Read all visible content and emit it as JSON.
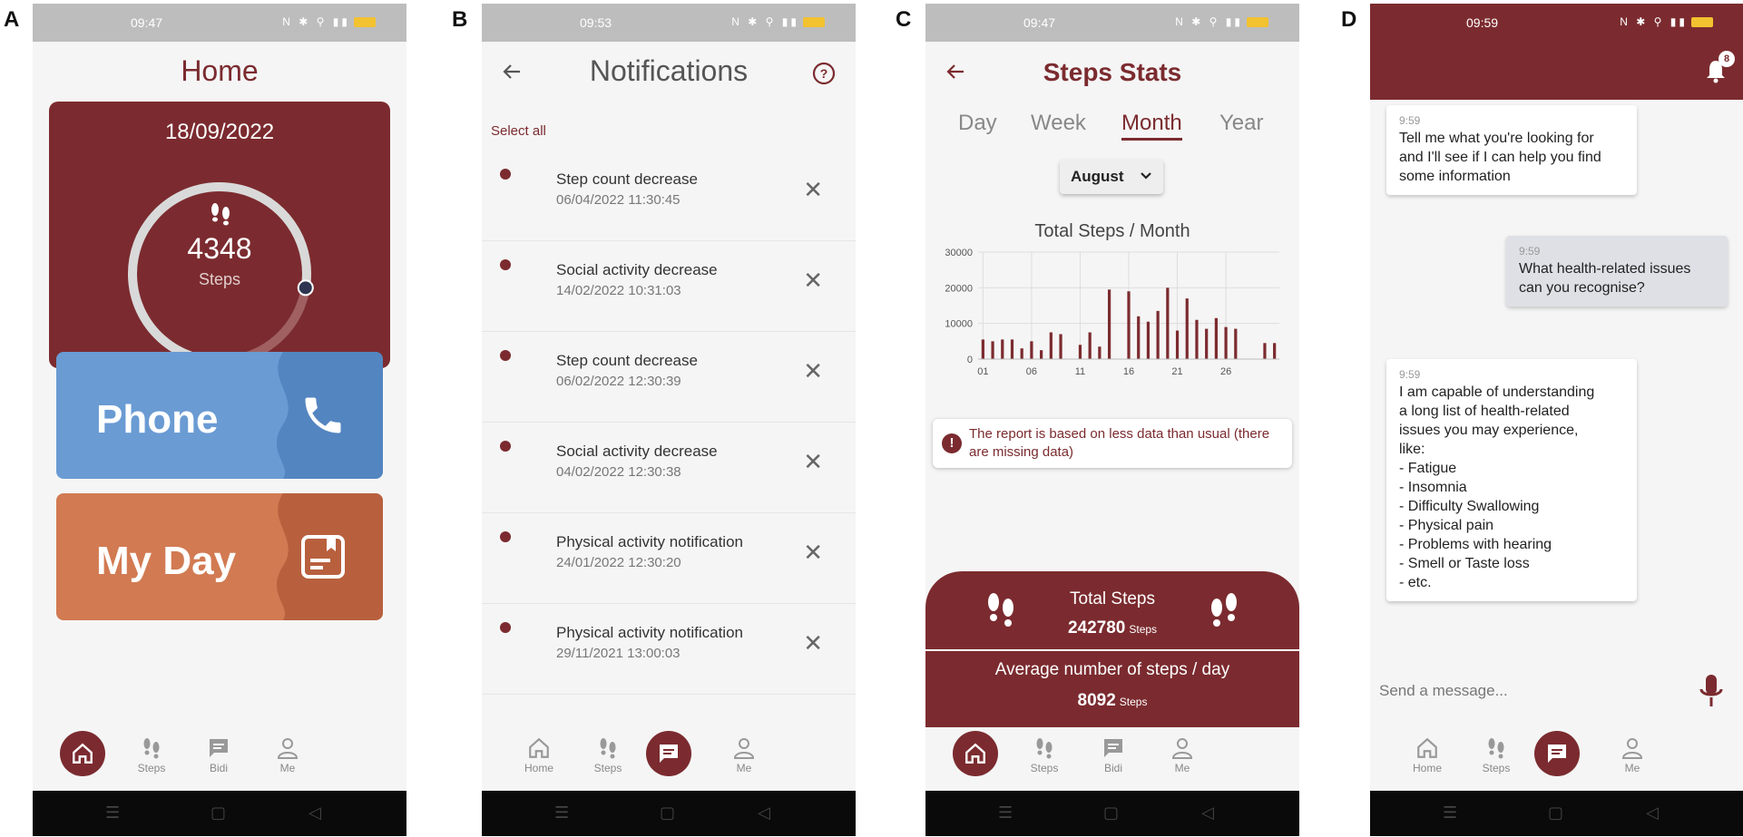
{
  "panel_labels": {
    "a": "A",
    "b": "B",
    "c": "C",
    "d": "D"
  },
  "colors": {
    "brand": "#7b2b2f",
    "phone_card": "#6a9bd3",
    "myday_card": "#d27a52",
    "status_bar": "#bdbdbd"
  },
  "panel_a": {
    "status_time": "09:47",
    "title": "Home",
    "date": "18/09/2022",
    "step_count": "4348",
    "step_label": "Steps",
    "step_progress": 0.72,
    "phone_label": "Phone",
    "myday_label": "My Day",
    "nav": {
      "home": "",
      "steps": "Steps",
      "bidi": "Bidi",
      "me": "Me"
    }
  },
  "panel_b": {
    "status_time": "09:53",
    "title": "Notifications",
    "select_all": "Select all",
    "items": [
      {
        "title": "Step count decrease",
        "date": "06/04/2022 11:30:45"
      },
      {
        "title": "Social activity decrease",
        "date": "14/02/2022 10:31:03"
      },
      {
        "title": "Step count decrease",
        "date": "06/02/2022 12:30:39"
      },
      {
        "title": "Social activity decrease",
        "date": "04/02/2022 12:30:38"
      },
      {
        "title": "Physical activity notification",
        "date": "24/01/2022 12:30:20"
      },
      {
        "title": "Physical activity notification",
        "date": "29/11/2021 13:00:03"
      }
    ],
    "nav": {
      "home": "Home",
      "steps": "Steps",
      "bidi": "",
      "me": "Me"
    }
  },
  "panel_c": {
    "status_time": "09:47",
    "title": "Steps Stats",
    "tabs": [
      "Day",
      "Week",
      "Month",
      "Year"
    ],
    "active_tab": "Month",
    "month": "August",
    "warning": "The report is based on less data than usual (there are missing data)",
    "total_label": "Total Steps",
    "total_value": "242780",
    "avg_label": "Average number of steps / day",
    "avg_value": "8092",
    "unit": "Steps",
    "nav": {
      "home": "",
      "steps": "Steps",
      "bidi": "Bidi",
      "me": "Me"
    }
  },
  "panel_d": {
    "status_time": "09:59",
    "badge": "8",
    "messages": [
      {
        "time": "9:59",
        "text": "Tell me what you're looking for\nand I'll see if I can help you find\nsome information",
        "from": "bot"
      },
      {
        "time": "9:59",
        "text": "What health-related issues\ncan you recognise?",
        "from": "user"
      },
      {
        "time": "9:59",
        "text": "I am capable of understanding\na long list of health-related\nissues you may experience,\nlike:\n- Fatigue\n- Insomnia\n- Difficulty Swallowing\n- Physical pain\n- Problems with hearing\n- Smell or Taste loss\n- etc.",
        "from": "bot"
      }
    ],
    "input_placeholder": "Send a message...",
    "nav": {
      "home": "Home",
      "steps": "Steps",
      "bidi": "",
      "me": "Me"
    }
  },
  "chart_data": {
    "type": "bar",
    "title": "Total Steps / Month",
    "xlabel": "",
    "ylabel": "",
    "x": [
      1,
      2,
      3,
      4,
      5,
      6,
      7,
      8,
      9,
      10,
      11,
      12,
      13,
      14,
      15,
      16,
      17,
      18,
      19,
      20,
      21,
      22,
      23,
      24,
      25,
      26,
      27,
      28,
      29,
      30,
      31
    ],
    "values": [
      5500,
      5000,
      5500,
      5500,
      3000,
      5000,
      2500,
      7500,
      7000,
      0,
      4000,
      7500,
      3500,
      19500,
      0,
      19000,
      12000,
      10500,
      13500,
      20000,
      8000,
      17000,
      11000,
      8500,
      11500,
      9000,
      8500,
      0,
      0,
      4500,
      4500
    ],
    "x_ticks": [
      "01",
      "06",
      "11",
      "16",
      "21",
      "26"
    ],
    "y_ticks": [
      "0",
      "10000",
      "20000",
      "30000"
    ],
    "ylim": [
      0,
      30000
    ],
    "grid": true
  }
}
